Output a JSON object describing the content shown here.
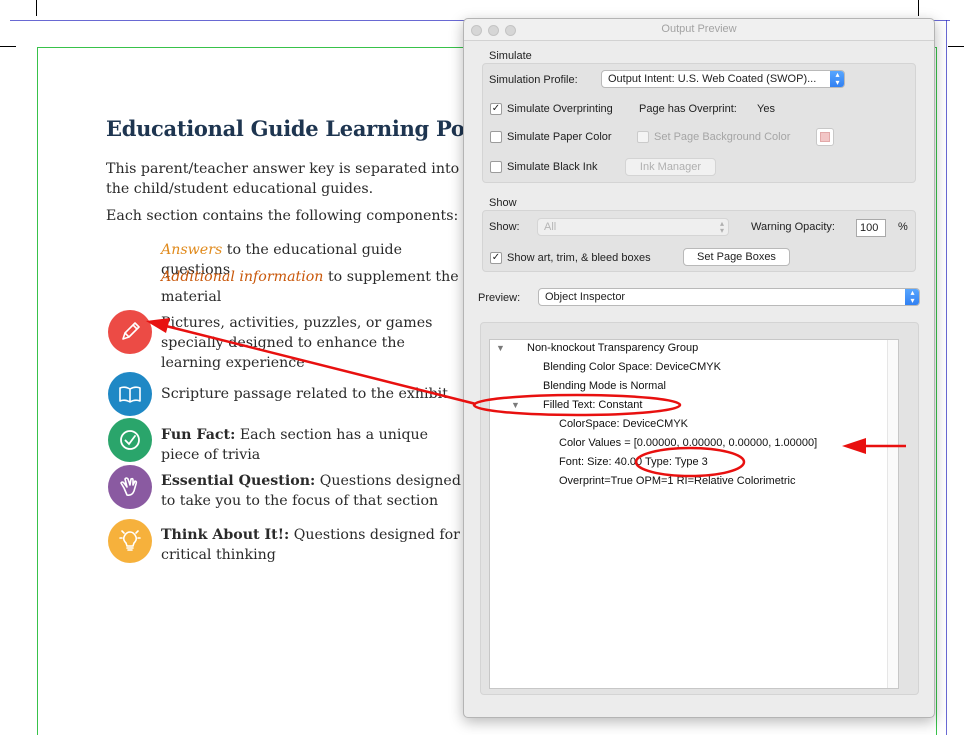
{
  "document": {
    "title": "Educational Guide Learning Points",
    "intro_line1": "This parent/teacher answer key is separated into sections that correspond to",
    "intro_line2": "the child/student educational guides.",
    "intro_components": "Each section contains the following components:",
    "items": [
      {
        "lead": "Answers",
        "rest": " to the educational guide questions"
      },
      {
        "lead": "Additional information",
        "rest": " to supplement the material"
      },
      {
        "icon": "pencil-icon",
        "text": "Pictures, activities, puzzles, or games specially designed to enhance the learning experience"
      },
      {
        "icon": "open-book-icon",
        "text": "Scripture passage related to the exhibit"
      },
      {
        "icon": "checkmark-icon",
        "bold": "Fun Fact:",
        "text": " Each section has a unique piece of trivia"
      },
      {
        "icon": "pointing-hand-icon",
        "bold": "Essential Question:",
        "text": " Questions designed to take you to the focus of that section"
      },
      {
        "icon": "lightbulb-icon",
        "bold": "Think About It!:",
        "text": " Questions designed for critical thinking"
      }
    ]
  },
  "dialog": {
    "title": "Output Preview",
    "simulate": {
      "section_label": "Simulate",
      "profile_label": "Simulation Profile:",
      "profile_value": "Output Intent: U.S. Web Coated (SWOP)...",
      "overprinting_label": "Simulate Overprinting",
      "overprinting_checked": true,
      "page_overprint_label": "Page has Overprint:",
      "page_overprint_value": "Yes",
      "paper_color_label": "Simulate Paper Color",
      "bg_color_label": "Set Page Background Color",
      "black_ink_label": "Simulate Black Ink",
      "ink_manager_label": "Ink Manager"
    },
    "show": {
      "section_label": "Show",
      "show_label": "Show:",
      "show_value": "All",
      "warning_opacity_label": "Warning Opacity:",
      "warning_opacity_value": "100",
      "percent": "%",
      "boxes_label": "Show art, trim, & bleed boxes",
      "boxes_checked": true,
      "set_page_boxes_label": "Set Page Boxes"
    },
    "preview": {
      "label": "Preview:",
      "value": "Object Inspector"
    },
    "tree": [
      "Non-knockout Transparency Group",
      "Blending Color Space: DeviceCMYK",
      "Blending Mode is Normal",
      "Filled Text: Constant",
      "ColorSpace: DeviceCMYK",
      "Color Values = [0.00000, 0.00000, 0.00000, 1.00000]",
      "Font:  Size: 40.00 Type: Type 3",
      "Overprint=True OPM=1 RI=Relative Colorimetric"
    ]
  },
  "colors": {
    "annotation_red": "#e8100f",
    "icon_red": "#ec4b45",
    "icon_blue": "#1f88c5",
    "icon_green": "#2aa56b",
    "icon_purple": "#8a5aa1",
    "icon_orange": "#f6b13c"
  }
}
